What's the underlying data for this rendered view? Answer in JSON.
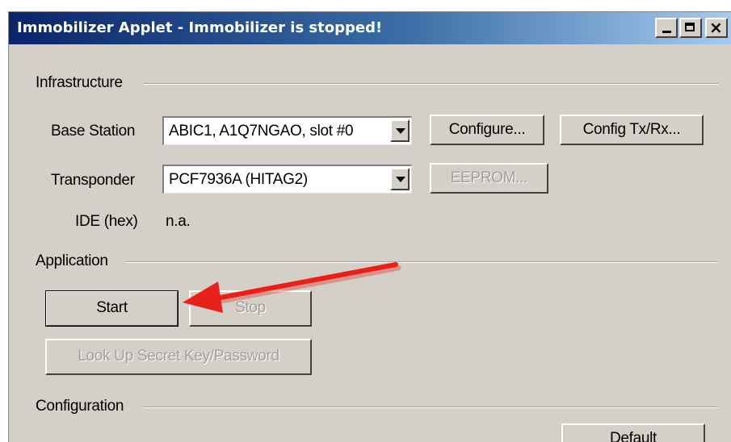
{
  "window": {
    "title": "Immobilizer Applet - Immobilizer is stopped!",
    "controls": {
      "minimize_icon": "minimize-icon",
      "maximize_icon": "maximize-icon",
      "close_icon": "close-icon",
      "close_glyph": "×"
    }
  },
  "infrastructure": {
    "group_label": "Infrastructure",
    "base_station_label": "Base Station",
    "base_station_value": "ABIC1, A1Q7NGAO, slot #0",
    "configure_label": "Configure...",
    "config_txrx_label": "Config Tx/Rx...",
    "transponder_label": "Transponder",
    "transponder_value": "PCF7936A (HITAG2)",
    "eeprom_label": "EEPROM...",
    "ide_label": "IDE (hex)",
    "ide_value": "n.a."
  },
  "application": {
    "group_label": "Application",
    "start_label": "Start",
    "stop_label": "Stop",
    "lookup_label": "Look Up Secret Key/Password"
  },
  "configuration": {
    "group_label": "Configuration",
    "default_label": "Default"
  },
  "annotation": {
    "arrow_color": "#e8201a"
  }
}
